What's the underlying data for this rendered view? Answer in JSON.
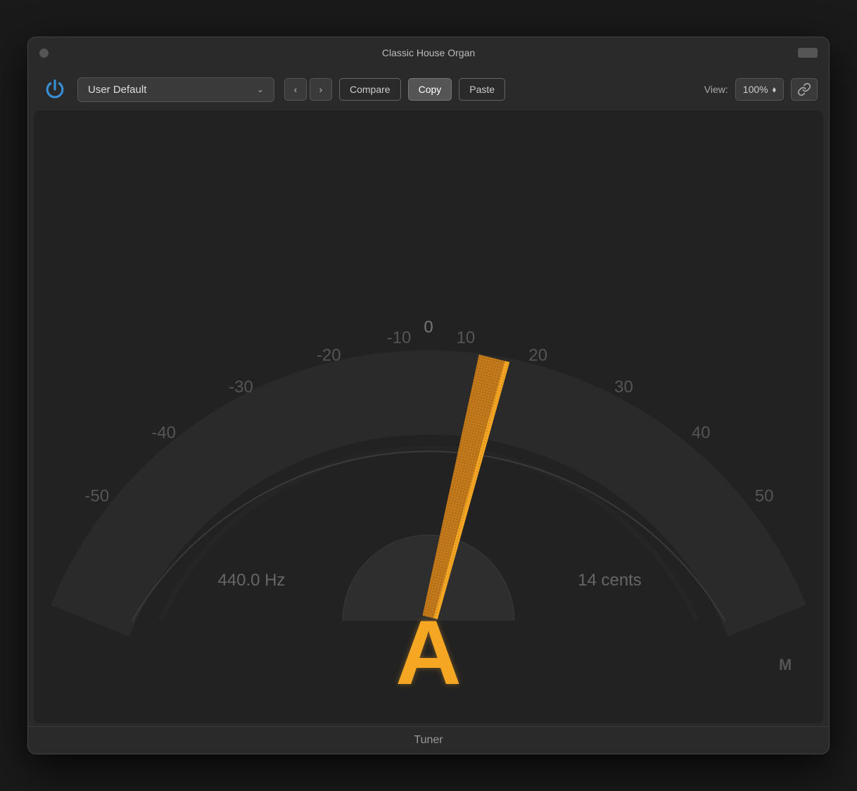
{
  "window": {
    "title": "Classic House Organ",
    "footer_label": "Tuner"
  },
  "toolbar": {
    "preset_label": "User Default",
    "prev_label": "‹",
    "next_label": "›",
    "compare_label": "Compare",
    "copy_label": "Copy",
    "paste_label": "Paste",
    "view_label": "View:",
    "view_percent": "100%",
    "link_icon": "🔗"
  },
  "tuner": {
    "note": "A",
    "frequency": "440.0 Hz",
    "cents": "14 cents",
    "m_badge": "M",
    "scale": {
      "minus50": "-50",
      "minus40": "-40",
      "minus30": "-30",
      "minus20": "-20",
      "minus10": "-10",
      "zero": "0",
      "plus10": "10",
      "plus20": "20",
      "plus30": "30",
      "plus40": "40",
      "plus50": "50"
    }
  },
  "colors": {
    "accent": "#f5a623",
    "power_blue": "#3a8fd4"
  }
}
